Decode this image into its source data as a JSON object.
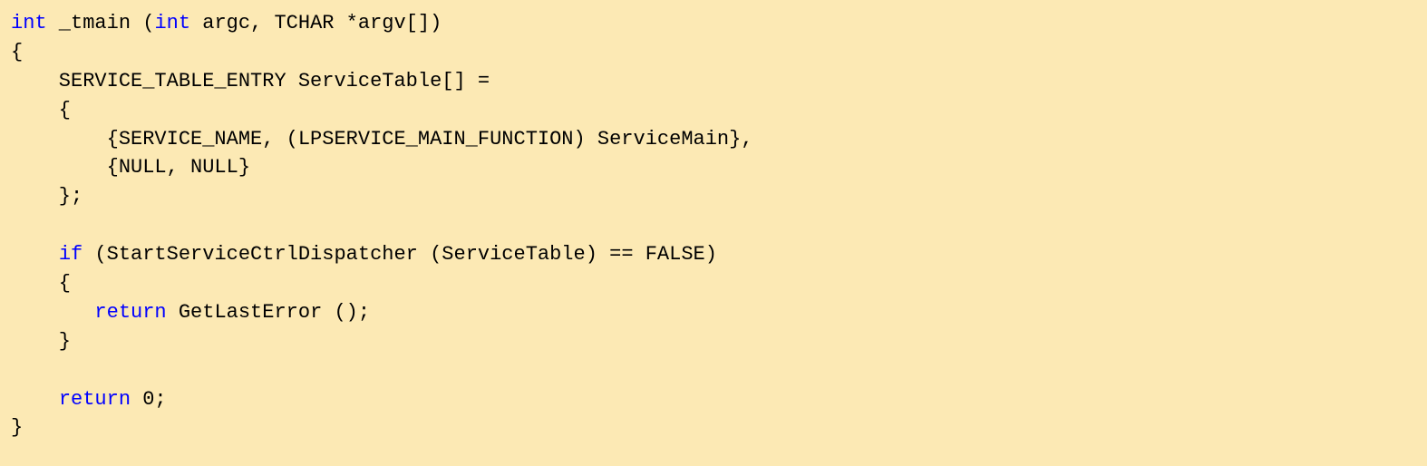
{
  "code": {
    "lines": [
      {
        "segments": [
          {
            "type": "keyword",
            "text": "int"
          },
          {
            "type": "rest",
            "text": " _tmain ("
          },
          {
            "type": "keyword",
            "text": "int"
          },
          {
            "type": "rest",
            "text": " argc, TCHAR *argv[])"
          }
        ]
      },
      {
        "segments": [
          {
            "type": "rest",
            "text": "{"
          }
        ]
      },
      {
        "segments": [
          {
            "type": "rest",
            "text": "    SERVICE_TABLE_ENTRY ServiceTable[] ="
          }
        ]
      },
      {
        "segments": [
          {
            "type": "rest",
            "text": "    {"
          }
        ]
      },
      {
        "segments": [
          {
            "type": "rest",
            "text": "        {SERVICE_NAME, (LPSERVICE_MAIN_FUNCTION) ServiceMain},"
          }
        ]
      },
      {
        "segments": [
          {
            "type": "rest",
            "text": "        {NULL, NULL}"
          }
        ]
      },
      {
        "segments": [
          {
            "type": "rest",
            "text": "    };"
          }
        ]
      },
      {
        "segments": [
          {
            "type": "rest",
            "text": ""
          }
        ]
      },
      {
        "segments": [
          {
            "type": "rest",
            "text": "    "
          },
          {
            "type": "keyword",
            "text": "if"
          },
          {
            "type": "rest",
            "text": " (StartServiceCtrlDispatcher (ServiceTable) == FALSE)"
          }
        ]
      },
      {
        "segments": [
          {
            "type": "rest",
            "text": "    {"
          }
        ]
      },
      {
        "segments": [
          {
            "type": "rest",
            "text": "       "
          },
          {
            "type": "keyword",
            "text": "return"
          },
          {
            "type": "rest",
            "text": " GetLastError ();"
          }
        ]
      },
      {
        "segments": [
          {
            "type": "rest",
            "text": "    }"
          }
        ]
      },
      {
        "segments": [
          {
            "type": "rest",
            "text": ""
          }
        ]
      },
      {
        "segments": [
          {
            "type": "rest",
            "text": "    "
          },
          {
            "type": "keyword",
            "text": "return"
          },
          {
            "type": "rest",
            "text": " 0;"
          }
        ]
      },
      {
        "segments": [
          {
            "type": "rest",
            "text": "}"
          }
        ]
      }
    ]
  }
}
